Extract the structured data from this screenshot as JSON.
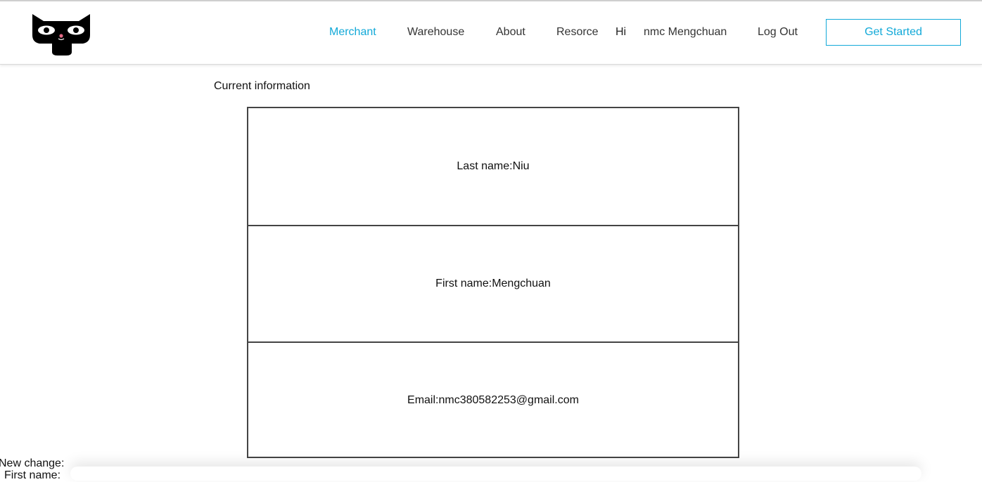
{
  "header": {
    "logo_icon": "cat-face-logo-icon",
    "nav": {
      "merchant": "Merchant",
      "warehouse": "Warehouse",
      "about": "About",
      "resource": "Resorce",
      "greeting": "Hi",
      "username": "nmc Mengchuan",
      "logout": "Log Out"
    },
    "cta_label": "Get Started",
    "accent_color": "#12a9d8"
  },
  "main": {
    "section_title": "Current information",
    "rows": [
      {
        "text": "Last name:Niu"
      },
      {
        "text": "First name:Mengchuan"
      },
      {
        "text": "Email:nmc380582253@gmail.com"
      }
    ],
    "new_change_label": "New change:",
    "first_name_label": "First name:"
  }
}
